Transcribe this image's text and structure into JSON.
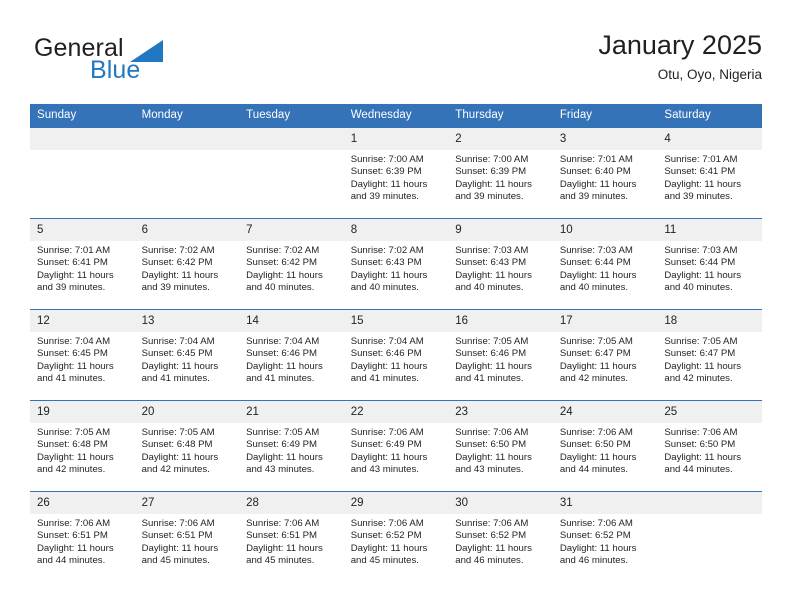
{
  "brand": {
    "name_part1": "General",
    "name_part2": "Blue",
    "flag_icon": "blue-triangle-flag-icon",
    "colors": {
      "general": "#231f20",
      "blue": "#1f78c1",
      "flag": "#1f78c1"
    }
  },
  "header": {
    "title": "January 2025",
    "subtitle": "Otu, Oyo, Nigeria"
  },
  "theme": {
    "header_row_bg": "#3573b9",
    "header_row_text": "#ffffff",
    "daynum_bg": "#f0f0f0",
    "row_divider": "#3573b9",
    "cell_bg": "#ffffff",
    "text": "#231f20"
  },
  "weekdays": [
    "Sunday",
    "Monday",
    "Tuesday",
    "Wednesday",
    "Thursday",
    "Friday",
    "Saturday"
  ],
  "labels": {
    "sunrise_prefix": "Sunrise:",
    "sunset_prefix": "Sunset:",
    "daylight_prefix": "Daylight:"
  },
  "weeks": [
    [
      {
        "day": "",
        "empty": true
      },
      {
        "day": "",
        "empty": true
      },
      {
        "day": "",
        "empty": true
      },
      {
        "day": "1",
        "sunrise": "Sunrise: 7:00 AM",
        "sunset": "Sunset: 6:39 PM",
        "daylight_line1": "Daylight: 11 hours",
        "daylight_line2": "and 39 minutes."
      },
      {
        "day": "2",
        "sunrise": "Sunrise: 7:00 AM",
        "sunset": "Sunset: 6:39 PM",
        "daylight_line1": "Daylight: 11 hours",
        "daylight_line2": "and 39 minutes."
      },
      {
        "day": "3",
        "sunrise": "Sunrise: 7:01 AM",
        "sunset": "Sunset: 6:40 PM",
        "daylight_line1": "Daylight: 11 hours",
        "daylight_line2": "and 39 minutes."
      },
      {
        "day": "4",
        "sunrise": "Sunrise: 7:01 AM",
        "sunset": "Sunset: 6:41 PM",
        "daylight_line1": "Daylight: 11 hours",
        "daylight_line2": "and 39 minutes."
      }
    ],
    [
      {
        "day": "5",
        "sunrise": "Sunrise: 7:01 AM",
        "sunset": "Sunset: 6:41 PM",
        "daylight_line1": "Daylight: 11 hours",
        "daylight_line2": "and 39 minutes."
      },
      {
        "day": "6",
        "sunrise": "Sunrise: 7:02 AM",
        "sunset": "Sunset: 6:42 PM",
        "daylight_line1": "Daylight: 11 hours",
        "daylight_line2": "and 39 minutes."
      },
      {
        "day": "7",
        "sunrise": "Sunrise: 7:02 AM",
        "sunset": "Sunset: 6:42 PM",
        "daylight_line1": "Daylight: 11 hours",
        "daylight_line2": "and 40 minutes."
      },
      {
        "day": "8",
        "sunrise": "Sunrise: 7:02 AM",
        "sunset": "Sunset: 6:43 PM",
        "daylight_line1": "Daylight: 11 hours",
        "daylight_line2": "and 40 minutes."
      },
      {
        "day": "9",
        "sunrise": "Sunrise: 7:03 AM",
        "sunset": "Sunset: 6:43 PM",
        "daylight_line1": "Daylight: 11 hours",
        "daylight_line2": "and 40 minutes."
      },
      {
        "day": "10",
        "sunrise": "Sunrise: 7:03 AM",
        "sunset": "Sunset: 6:44 PM",
        "daylight_line1": "Daylight: 11 hours",
        "daylight_line2": "and 40 minutes."
      },
      {
        "day": "11",
        "sunrise": "Sunrise: 7:03 AM",
        "sunset": "Sunset: 6:44 PM",
        "daylight_line1": "Daylight: 11 hours",
        "daylight_line2": "and 40 minutes."
      }
    ],
    [
      {
        "day": "12",
        "sunrise": "Sunrise: 7:04 AM",
        "sunset": "Sunset: 6:45 PM",
        "daylight_line1": "Daylight: 11 hours",
        "daylight_line2": "and 41 minutes."
      },
      {
        "day": "13",
        "sunrise": "Sunrise: 7:04 AM",
        "sunset": "Sunset: 6:45 PM",
        "daylight_line1": "Daylight: 11 hours",
        "daylight_line2": "and 41 minutes."
      },
      {
        "day": "14",
        "sunrise": "Sunrise: 7:04 AM",
        "sunset": "Sunset: 6:46 PM",
        "daylight_line1": "Daylight: 11 hours",
        "daylight_line2": "and 41 minutes."
      },
      {
        "day": "15",
        "sunrise": "Sunrise: 7:04 AM",
        "sunset": "Sunset: 6:46 PM",
        "daylight_line1": "Daylight: 11 hours",
        "daylight_line2": "and 41 minutes."
      },
      {
        "day": "16",
        "sunrise": "Sunrise: 7:05 AM",
        "sunset": "Sunset: 6:46 PM",
        "daylight_line1": "Daylight: 11 hours",
        "daylight_line2": "and 41 minutes."
      },
      {
        "day": "17",
        "sunrise": "Sunrise: 7:05 AM",
        "sunset": "Sunset: 6:47 PM",
        "daylight_line1": "Daylight: 11 hours",
        "daylight_line2": "and 42 minutes."
      },
      {
        "day": "18",
        "sunrise": "Sunrise: 7:05 AM",
        "sunset": "Sunset: 6:47 PM",
        "daylight_line1": "Daylight: 11 hours",
        "daylight_line2": "and 42 minutes."
      }
    ],
    [
      {
        "day": "19",
        "sunrise": "Sunrise: 7:05 AM",
        "sunset": "Sunset: 6:48 PM",
        "daylight_line1": "Daylight: 11 hours",
        "daylight_line2": "and 42 minutes."
      },
      {
        "day": "20",
        "sunrise": "Sunrise: 7:05 AM",
        "sunset": "Sunset: 6:48 PM",
        "daylight_line1": "Daylight: 11 hours",
        "daylight_line2": "and 42 minutes."
      },
      {
        "day": "21",
        "sunrise": "Sunrise: 7:05 AM",
        "sunset": "Sunset: 6:49 PM",
        "daylight_line1": "Daylight: 11 hours",
        "daylight_line2": "and 43 minutes."
      },
      {
        "day": "22",
        "sunrise": "Sunrise: 7:06 AM",
        "sunset": "Sunset: 6:49 PM",
        "daylight_line1": "Daylight: 11 hours",
        "daylight_line2": "and 43 minutes."
      },
      {
        "day": "23",
        "sunrise": "Sunrise: 7:06 AM",
        "sunset": "Sunset: 6:50 PM",
        "daylight_line1": "Daylight: 11 hours",
        "daylight_line2": "and 43 minutes."
      },
      {
        "day": "24",
        "sunrise": "Sunrise: 7:06 AM",
        "sunset": "Sunset: 6:50 PM",
        "daylight_line1": "Daylight: 11 hours",
        "daylight_line2": "and 44 minutes."
      },
      {
        "day": "25",
        "sunrise": "Sunrise: 7:06 AM",
        "sunset": "Sunset: 6:50 PM",
        "daylight_line1": "Daylight: 11 hours",
        "daylight_line2": "and 44 minutes."
      }
    ],
    [
      {
        "day": "26",
        "sunrise": "Sunrise: 7:06 AM",
        "sunset": "Sunset: 6:51 PM",
        "daylight_line1": "Daylight: 11 hours",
        "daylight_line2": "and 44 minutes."
      },
      {
        "day": "27",
        "sunrise": "Sunrise: 7:06 AM",
        "sunset": "Sunset: 6:51 PM",
        "daylight_line1": "Daylight: 11 hours",
        "daylight_line2": "and 45 minutes."
      },
      {
        "day": "28",
        "sunrise": "Sunrise: 7:06 AM",
        "sunset": "Sunset: 6:51 PM",
        "daylight_line1": "Daylight: 11 hours",
        "daylight_line2": "and 45 minutes."
      },
      {
        "day": "29",
        "sunrise": "Sunrise: 7:06 AM",
        "sunset": "Sunset: 6:52 PM",
        "daylight_line1": "Daylight: 11 hours",
        "daylight_line2": "and 45 minutes."
      },
      {
        "day": "30",
        "sunrise": "Sunrise: 7:06 AM",
        "sunset": "Sunset: 6:52 PM",
        "daylight_line1": "Daylight: 11 hours",
        "daylight_line2": "and 46 minutes."
      },
      {
        "day": "31",
        "sunrise": "Sunrise: 7:06 AM",
        "sunset": "Sunset: 6:52 PM",
        "daylight_line1": "Daylight: 11 hours",
        "daylight_line2": "and 46 minutes."
      },
      {
        "day": "",
        "empty": true
      }
    ]
  ]
}
